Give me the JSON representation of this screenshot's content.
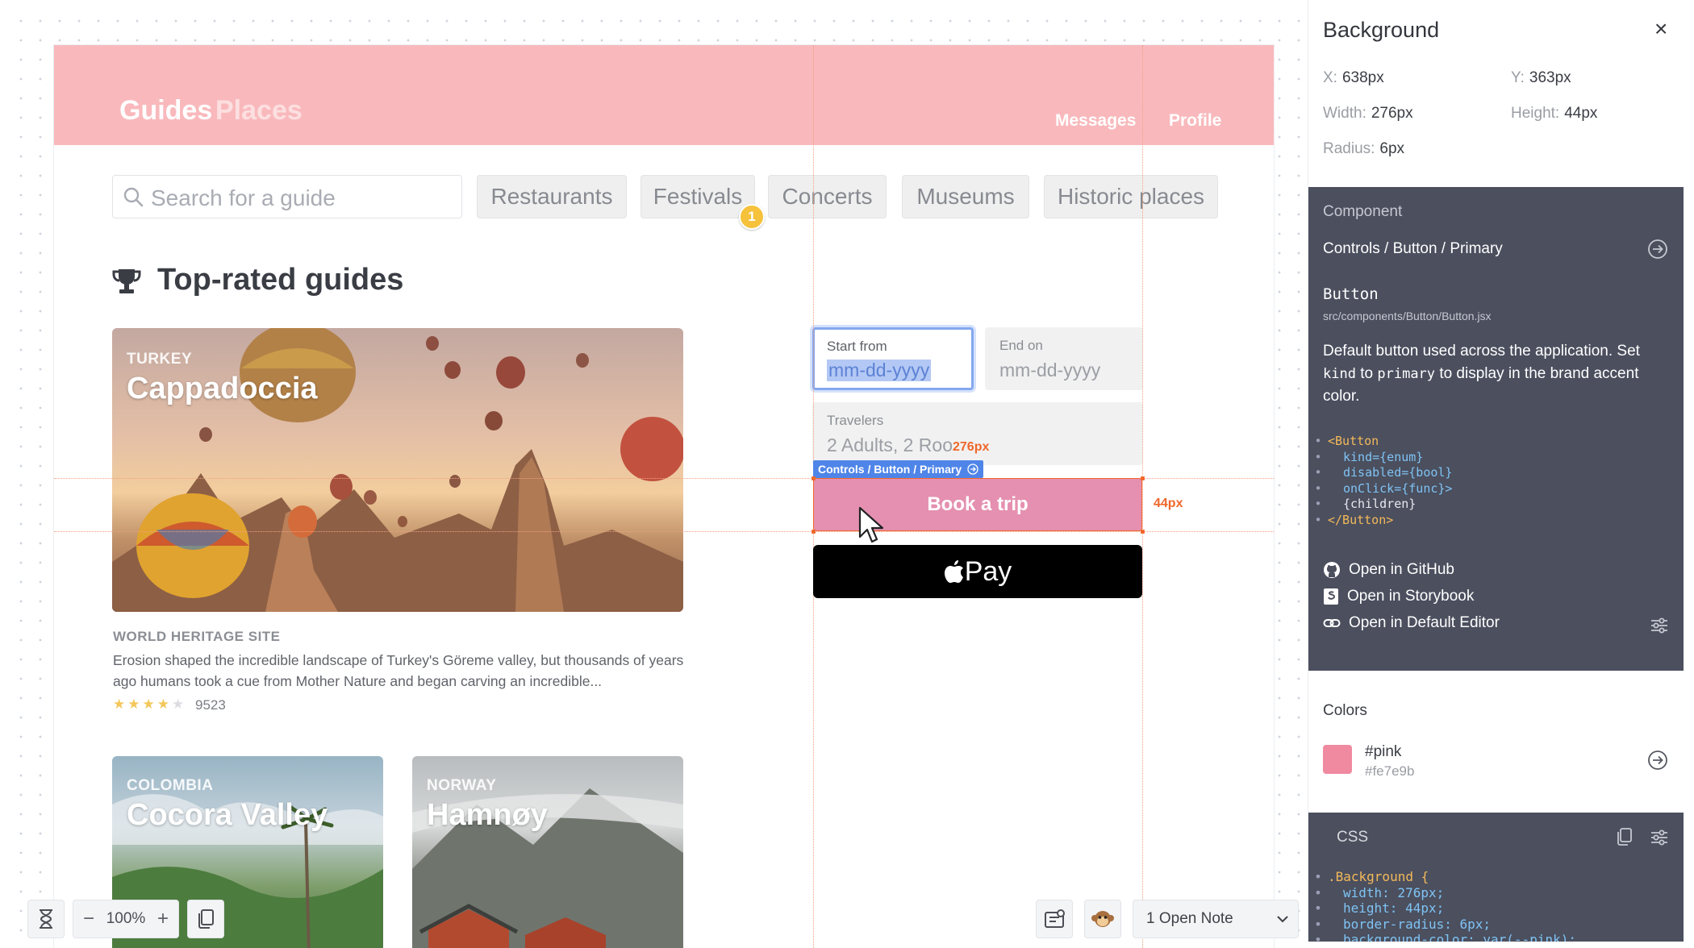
{
  "app": {
    "nav": {
      "guides": "Guides",
      "places": "Places",
      "messages": "Messages",
      "profile": "Profile"
    },
    "search": {
      "placeholder": "Search for a guide",
      "icon": "search-icon"
    },
    "filters": [
      "Restaurants",
      "Festivals",
      "Concerts",
      "Museums",
      "Historic places"
    ],
    "filter_badge": "1",
    "section_title": "Top-rated guides",
    "cards": [
      {
        "country": "TURKEY",
        "name": "Cappadoccia"
      },
      {
        "country": "COLOMBIA",
        "name": "Cocora Valley"
      },
      {
        "country": "NORWAY",
        "name": "Hamnøy"
      }
    ],
    "featured": {
      "tag": "WORLD HERITAGE SITE",
      "description": "Erosion shaped the incredible landscape of Turkey's Göreme valley, but thousands of years ago humans took a cue from Mother Nature and began carving an incredible...",
      "rating": 4.5,
      "reviews": "9523"
    },
    "booking": {
      "start_label": "Start from",
      "start_value": "mm-dd-yyyy",
      "end_label": "End on",
      "end_value": "mm-dd-yyyy",
      "travelers_label": "Travelers",
      "travelers_value": "2 Adults, 2 Roo",
      "book_button": "Book a trip",
      "apple_pay": "Pay"
    }
  },
  "inspector": {
    "width_measure": "276px",
    "height_measure": "44px",
    "component_tag": "Controls / Button / Primary"
  },
  "toolbar": {
    "zoom": "100%",
    "zoom_minus": "−",
    "zoom_plus": "+",
    "notes": "1 Open Note"
  },
  "panel": {
    "title": "Background",
    "close": "×",
    "x_label": "X:",
    "x_value": "638px",
    "y_label": "Y:",
    "y_value": "363px",
    "width_label": "Width:",
    "width_value": "276px",
    "height_label": "Height:",
    "height_value": "44px",
    "radius_label": "Radius:",
    "radius_value": "6px",
    "component_heading": "Component",
    "component_path": "Controls / Button / Primary",
    "component_name": "Button",
    "component_file": "src/components/Button/Button.jsx",
    "desc_1": "Default button used across the application. Set",
    "desc_kind": "kind",
    "desc_to": "to",
    "desc_primary": "primary",
    "desc_2": "to display in the brand accent color.",
    "code_lines": [
      "<Button",
      "kind={enum}",
      "disabled={bool}",
      "onClick={func}>",
      "{children}",
      "</Button>"
    ],
    "links": {
      "github": "Open in GitHub",
      "storybook": "Open in Storybook",
      "editor": "Open in Default Editor"
    },
    "colors_heading": "Colors",
    "color_name": "#pink",
    "color_hex": "#fe7e9b",
    "css_heading": "CSS",
    "css_lines": [
      ".Background {",
      "width: 276px;",
      "height: 44px;",
      "border-radius: 6px;",
      "background-color: var(--pink);"
    ]
  },
  "colors": {
    "brand_pink": "#f9b9bc",
    "button_pink": "#e590b0",
    "guide_orange": "#f0672b",
    "selection_blue": "#4f85e8",
    "swatch": "#fe7e9b"
  }
}
